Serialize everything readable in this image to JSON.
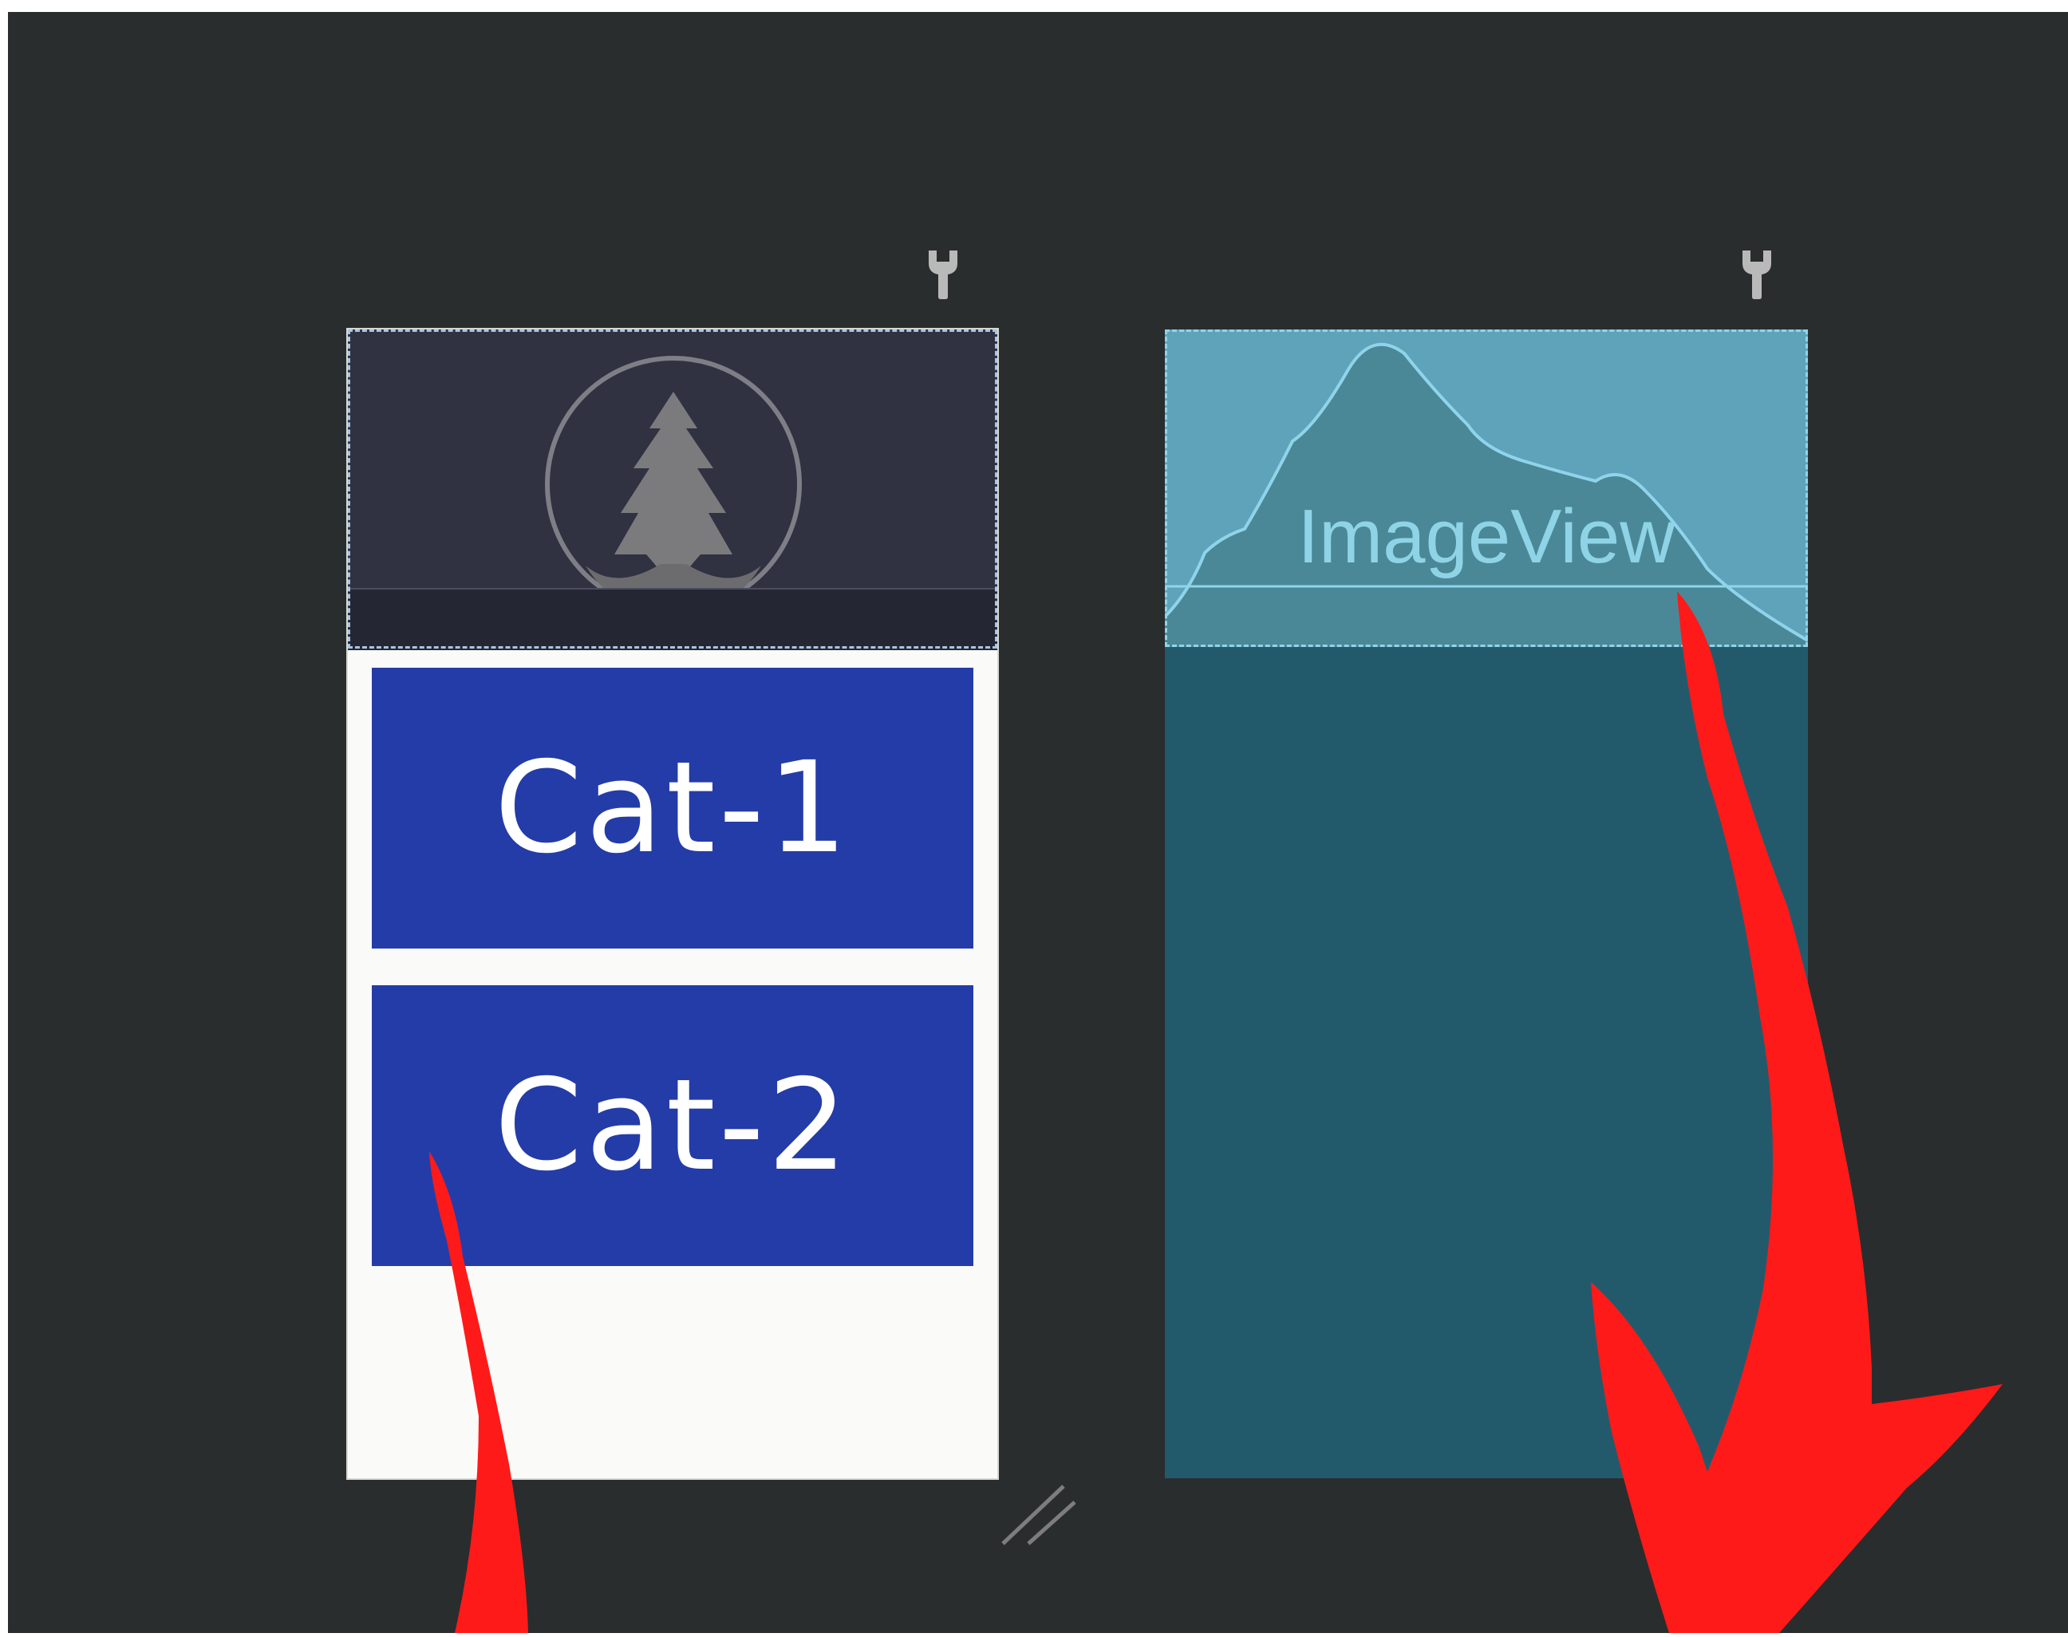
{
  "design_preview": {
    "cards": [
      {
        "label": "Cat-1"
      },
      {
        "label": "Cat-2"
      }
    ]
  },
  "blueprint_preview": {
    "image_view_label": "ImageView"
  },
  "icons": {
    "device_settings": "wrench-icon",
    "header_logo": "tree-logo",
    "image_placeholder": "mountain-icon",
    "resize": "resize-handle-icon"
  },
  "colors": {
    "canvas_background": "#2a2d2e",
    "card_background": "#243ca8",
    "header_background": "#303141",
    "blueprint_background": "#235a6b",
    "image_view_fill": "#5ea3b9",
    "annotation_arrow": "#ff1a1a"
  }
}
